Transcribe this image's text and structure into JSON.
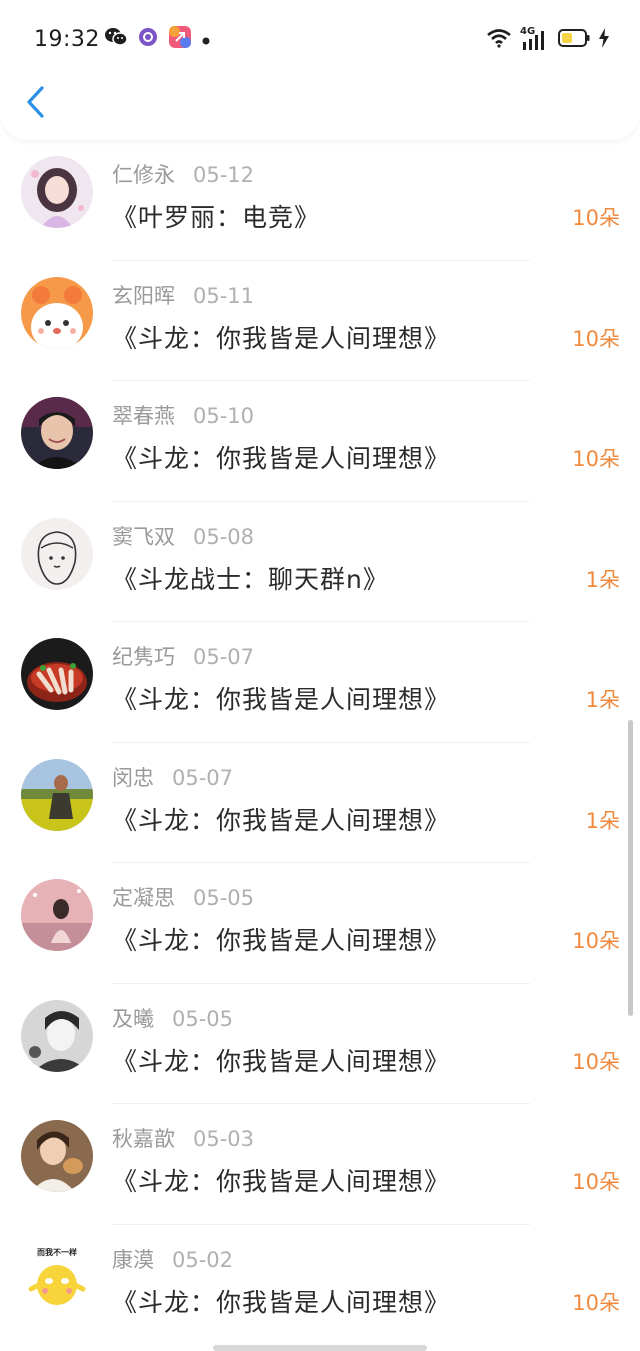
{
  "status_bar": {
    "time": "19:32",
    "network_label": "4G",
    "notification_icons": [
      "wechat-icon",
      "purple-app-icon",
      "shortcut-app-icon",
      "dot-icon"
    ],
    "right_icons": [
      "wifi-icon",
      "signal-icon",
      "battery-icon",
      "charging-icon"
    ]
  },
  "header": {
    "back_icon": "chevron-left-icon"
  },
  "colors": {
    "accent_blue": "#2b90e8",
    "amount_orange": "#f08a3e",
    "name_gray": "#9a9a9a",
    "battery_yellow": "#f5d547"
  },
  "gifts": [
    {
      "name": "仁修永",
      "date": "05-12",
      "title": "《叶罗丽：电竞》",
      "amount": "10朵"
    },
    {
      "name": "玄阳晖",
      "date": "05-11",
      "title": "《斗龙：你我皆是人间理想》",
      "amount": "10朵"
    },
    {
      "name": "翠春燕",
      "date": "05-10",
      "title": "《斗龙：你我皆是人间理想》",
      "amount": "10朵"
    },
    {
      "name": "窦飞双",
      "date": "05-08",
      "title": "《斗龙战士：聊天群n》",
      "amount": "1朵"
    },
    {
      "name": "纪隽巧",
      "date": "05-07",
      "title": "《斗龙：你我皆是人间理想》",
      "amount": "1朵"
    },
    {
      "name": "闵忠",
      "date": "05-07",
      "title": "《斗龙：你我皆是人间理想》",
      "amount": "1朵"
    },
    {
      "name": "定凝思",
      "date": "05-05",
      "title": "《斗龙：你我皆是人间理想》",
      "amount": "10朵"
    },
    {
      "name": "及曦",
      "date": "05-05",
      "title": "《斗龙：你我皆是人间理想》",
      "amount": "10朵"
    },
    {
      "name": "秋嘉歆",
      "date": "05-03",
      "title": "《斗龙：你我皆是人间理想》",
      "amount": "10朵"
    },
    {
      "name": "康漠",
      "date": "05-02",
      "title": "《斗龙：你我皆是人间理想》",
      "amount": "10朵"
    }
  ],
  "avatar_caption_10": "而我不一样"
}
